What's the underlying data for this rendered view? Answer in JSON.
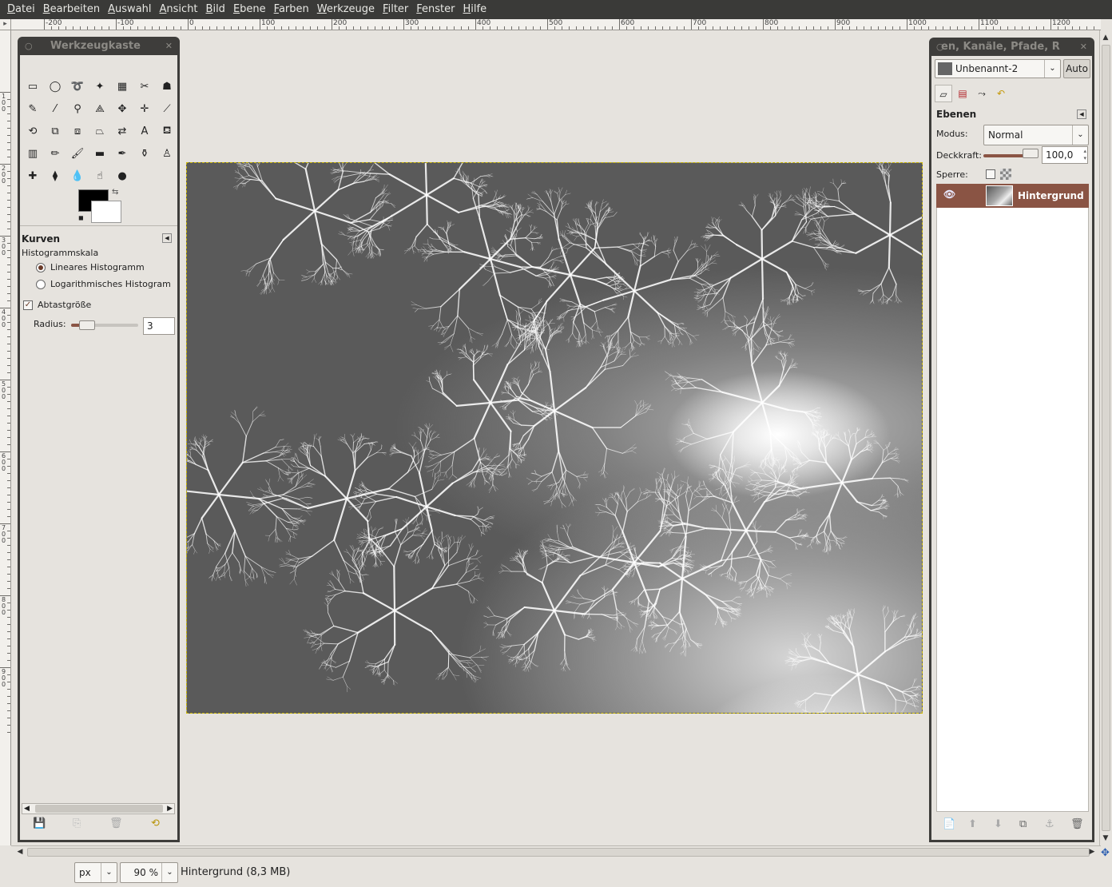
{
  "menubar": {
    "items": [
      "Datei",
      "Bearbeiten",
      "Auswahl",
      "Ansicht",
      "Bild",
      "Ebene",
      "Farben",
      "Werkzeuge",
      "Filter",
      "Fenster",
      "Hilfe"
    ]
  },
  "rulers": {
    "top_labels": [
      "-200",
      "-100",
      "0",
      "100",
      "200",
      "300",
      "400",
      "500",
      "600",
      "700",
      "800",
      "900",
      "1000",
      "1100",
      "1200"
    ],
    "left_labels": [
      "0",
      "100",
      "200",
      "300",
      "400",
      "500",
      "600",
      "700",
      "800",
      "900"
    ]
  },
  "toolbox": {
    "title": "Werkzeugkaste",
    "tools": [
      {
        "name": "rect-select-icon",
        "glyph": "▭"
      },
      {
        "name": "ellipse-select-icon",
        "glyph": "◯"
      },
      {
        "name": "free-select-icon",
        "glyph": "➰"
      },
      {
        "name": "fuzzy-select-icon",
        "glyph": "✦"
      },
      {
        "name": "color-select-icon",
        "glyph": "▦"
      },
      {
        "name": "scissors-icon",
        "glyph": "✂"
      },
      {
        "name": "foreground-select-icon",
        "glyph": "☗"
      },
      {
        "name": "paths-icon",
        "glyph": "✎"
      },
      {
        "name": "color-picker-icon",
        "glyph": "⁄"
      },
      {
        "name": "zoom-icon",
        "glyph": "⚲"
      },
      {
        "name": "measure-icon",
        "glyph": "⟁"
      },
      {
        "name": "move-icon",
        "glyph": "✥"
      },
      {
        "name": "align-icon",
        "glyph": "✛"
      },
      {
        "name": "crop-icon",
        "glyph": "⟋"
      },
      {
        "name": "rotate-icon",
        "glyph": "⟲"
      },
      {
        "name": "scale-icon",
        "glyph": "⧉"
      },
      {
        "name": "shear-icon",
        "glyph": "⧈"
      },
      {
        "name": "perspective-icon",
        "glyph": "⏢"
      },
      {
        "name": "flip-icon",
        "glyph": "⇄"
      },
      {
        "name": "text-icon",
        "glyph": "A"
      },
      {
        "name": "bucket-fill-icon",
        "glyph": "⛾"
      },
      {
        "name": "blend-icon",
        "glyph": "▥"
      },
      {
        "name": "pencil-icon",
        "glyph": "✏"
      },
      {
        "name": "paintbrush-icon",
        "glyph": "🖌"
      },
      {
        "name": "eraser-icon",
        "glyph": "▬"
      },
      {
        "name": "airbrush-icon",
        "glyph": "✒"
      },
      {
        "name": "ink-icon",
        "glyph": "⚱"
      },
      {
        "name": "clone-icon",
        "glyph": "♙"
      },
      {
        "name": "heal-icon",
        "glyph": "✚"
      },
      {
        "name": "perspective-clone-icon",
        "glyph": "⧫"
      },
      {
        "name": "blur-icon",
        "glyph": "💧"
      },
      {
        "name": "smudge-icon",
        "glyph": "☝"
      },
      {
        "name": "dodge-burn-icon",
        "glyph": "●"
      }
    ],
    "options_title": "Kurven",
    "histogram_scale_label": "Histogrammskala",
    "radio_linear": "Lineares Histogramm",
    "radio_log": "Logarithmisches Histogram",
    "sample_merged": "Abtastgröße",
    "radius_label": "Radius:",
    "radius_value": "3"
  },
  "layers": {
    "image_selector": "Unbenannt-2",
    "auto_button": "Auto",
    "title": "en, Kanäle, Pfade, R",
    "panel_title": "Ebenen",
    "mode_label": "Modus:",
    "mode_value": "Normal",
    "opacity_label": "Deckkraft:",
    "opacity_value": "100,0",
    "lock_label": "Sperre:",
    "layer_name": "Hintergrund"
  },
  "status": {
    "unit": "px",
    "zoom": "90 %",
    "text": "Hintergrund (8,3 MB)"
  },
  "colors": {
    "menubar": "#3a3a38",
    "dock_frame": "#3e3d3b",
    "selected_layer": "#8a5444",
    "selection_marching": "#c8b400"
  }
}
